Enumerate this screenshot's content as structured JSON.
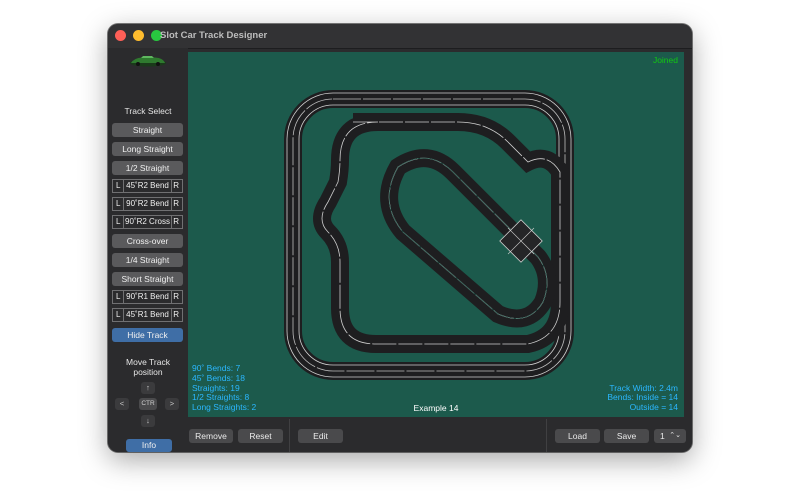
{
  "window": {
    "title": "Slot Car Track Designer"
  },
  "sidebar": {
    "track_select_label": "Track Select",
    "buttons": {
      "straight": "Straight",
      "long_straight": "Long Straight",
      "half_straight": "1/2 Straight",
      "bend_45_r2": "45˚R2 Bend",
      "bend_90_r2": "90˚R2 Bend",
      "cross_90_r2": "90˚R2 Cross",
      "crossover": "Cross-over",
      "quarter_straight": "1/4 Straight",
      "short_straight": "Short Straight",
      "bend_90_r1": "90˚R1 Bend",
      "bend_45_r1": "45˚R1 Bend",
      "hide_track": "Hide Track"
    },
    "left_marker": "L",
    "right_marker": "R",
    "move_track_label_1": "Move Track",
    "move_track_label_2": "position",
    "arrows": {
      "up": "↑",
      "left": "<",
      "center": "CTR",
      "right": ">",
      "down": "↓"
    },
    "info": "Info"
  },
  "canvas": {
    "status": "Joined",
    "example_name": "Example 14",
    "stats_left": {
      "bends_90": "90˚ Bends: 7",
      "bends_45": "45˚ Bends: 18",
      "straights": "Straights: 19",
      "half_straights": "1/2 Straights: 8",
      "long_straights": "Long Straights: 2"
    },
    "stats_right": {
      "track_width": "Track Width: 2.4m",
      "bends_inside": "Bends: Inside = 14",
      "bends_outside": "Outside = 14"
    },
    "colors": {
      "background": "#1c5a4c",
      "track": "#1e1e20",
      "rail": "#c8c8c8",
      "stats": "#2bb7ff",
      "joined": "#12c812"
    }
  },
  "bottombar": {
    "remove": "Remove",
    "reset": "Reset",
    "edit": "Edit",
    "load": "Load",
    "save": "Save",
    "slot_value": "1",
    "slot_arrow": "⌃⌄"
  }
}
